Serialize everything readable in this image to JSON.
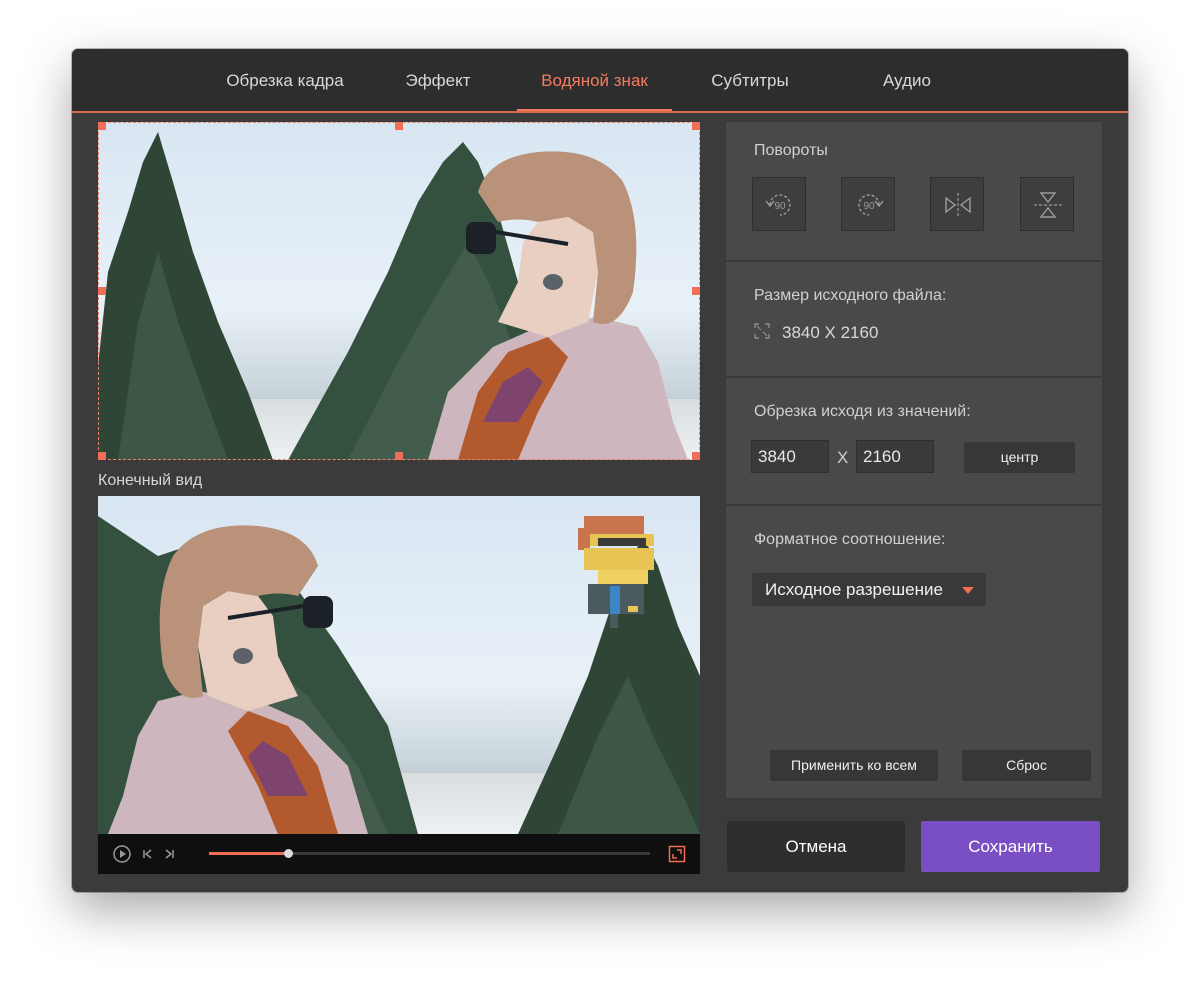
{
  "tabs": [
    {
      "label": "Обрезка кадра"
    },
    {
      "label": "Эффект"
    },
    {
      "label": "Водяной знак",
      "active": true
    },
    {
      "label": "Субтитры"
    },
    {
      "label": "Аудио"
    }
  ],
  "preview": {
    "final_view_label": "Конечный вид",
    "playback_progress": 0.18
  },
  "panel": {
    "rotations": {
      "title": "Повороты",
      "buttons": [
        {
          "icon": "rotate-left-90-icon",
          "text": "90"
        },
        {
          "icon": "rotate-right-90-icon",
          "text": "90"
        },
        {
          "icon": "flip-horizontal-icon"
        },
        {
          "icon": "flip-vertical-icon"
        }
      ]
    },
    "source_size": {
      "title": "Размер исходного файла:",
      "value": "3840 X 2160"
    },
    "crop": {
      "title": "Обрезка исходя из значений:",
      "width": "3840",
      "separator": "X",
      "height": "2160",
      "center_label": "центр"
    },
    "aspect": {
      "title": "Форматное соотношение:",
      "selected": "Исходное разрешение"
    },
    "apply_all_label": "Применить ко всем",
    "reset_label": "Сброс"
  },
  "footer": {
    "cancel_label": "Отмена",
    "save_label": "Сохранить"
  },
  "colors": {
    "accent": "#f47c5e",
    "save_button": "#7a4fc4",
    "window_bg": "#3c3b3b",
    "panel_bg": "#4a4949"
  }
}
